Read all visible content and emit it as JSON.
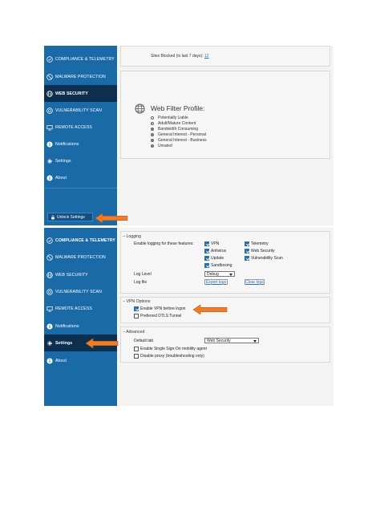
{
  "top_screenshot": {
    "sidebar": {
      "items": [
        {
          "label": "COMPLIANCE & TELEMETRY",
          "icon": "shield-check-icon"
        },
        {
          "label": "MALWARE PROTECTION",
          "icon": "malware-icon"
        },
        {
          "label": "WEB SECURITY",
          "icon": "globe-icon",
          "active": true
        },
        {
          "label": "VULNERABILITY SCAN",
          "icon": "target-icon"
        },
        {
          "label": "REMOTE ACCESS",
          "icon": "monitor-icon"
        },
        {
          "label": "Notifications",
          "icon": "info-icon"
        },
        {
          "label": "Settings",
          "icon": "gear-icon"
        },
        {
          "label": "About",
          "icon": "info-icon"
        }
      ],
      "unlock_label": "Unlock Settings"
    },
    "sites_blocked": {
      "label": "Sites Blocked (in last 7 days):",
      "value": "12"
    },
    "web_filter": {
      "title": "Web Filter Profile:",
      "items": [
        {
          "label": "Potentially Liable",
          "state": "empty"
        },
        {
          "label": "Adult/Mature Content",
          "state": "half"
        },
        {
          "label": "Bandwidth Consuming",
          "state": "filled"
        },
        {
          "label": "General Interest - Personal",
          "state": "filled"
        },
        {
          "label": "General Interest - Business",
          "state": "filled"
        },
        {
          "label": "Unrated",
          "state": "filled"
        }
      ]
    }
  },
  "bottom_screenshot": {
    "sidebar": {
      "items": [
        {
          "label": "COMPLIANCE & TELEMETRY",
          "icon": "shield-check-icon"
        },
        {
          "label": "MALWARE PROTECTION",
          "icon": "malware-icon"
        },
        {
          "label": "WEB SECURITY",
          "icon": "globe-icon"
        },
        {
          "label": "VULNERABILITY SCAN",
          "icon": "target-icon"
        },
        {
          "label": "REMOTE ACCESS",
          "icon": "monitor-icon"
        },
        {
          "label": "Notifications",
          "icon": "info-icon"
        },
        {
          "label": "Settings",
          "icon": "gear-icon",
          "active": true
        },
        {
          "label": "About",
          "icon": "info-icon"
        }
      ]
    },
    "logging": {
      "title": "Logging",
      "enable_label": "Enable logging for these features:",
      "features": [
        {
          "label": "VPN",
          "checked": true
        },
        {
          "label": "Telemetry",
          "checked": true
        },
        {
          "label": "Antivirus",
          "checked": true
        },
        {
          "label": "Web Security",
          "checked": true
        },
        {
          "label": "Update",
          "checked": true
        },
        {
          "label": "Vulnerability Scan",
          "checked": true
        },
        {
          "label": "Sandboxing",
          "checked": true
        }
      ],
      "log_level_label": "Log Level",
      "log_level_value": "Debug",
      "log_file_label": "Log file",
      "export_label": "Export logs",
      "clear_label": "Clear logs"
    },
    "vpn_options": {
      "title": "VPN Options",
      "items": [
        {
          "label": "Enable VPN before logon",
          "checked": true
        },
        {
          "label": "Preferred DTLS Tunnel",
          "checked": false
        }
      ]
    },
    "advanced": {
      "title": "Advanced",
      "default_tab_label": "Default tab",
      "default_tab_value": "Web Security",
      "items": [
        {
          "label": "Enable Single Sign-On mobility agent",
          "checked": false
        },
        {
          "label": "Disable proxy (troubleshooting only)",
          "checked": false
        }
      ]
    }
  },
  "colors": {
    "sidebar": "#1b6aa8",
    "sidebar_active": "#0d2f4f",
    "arrow": "#f07c2a",
    "link": "#2a6fb5"
  }
}
